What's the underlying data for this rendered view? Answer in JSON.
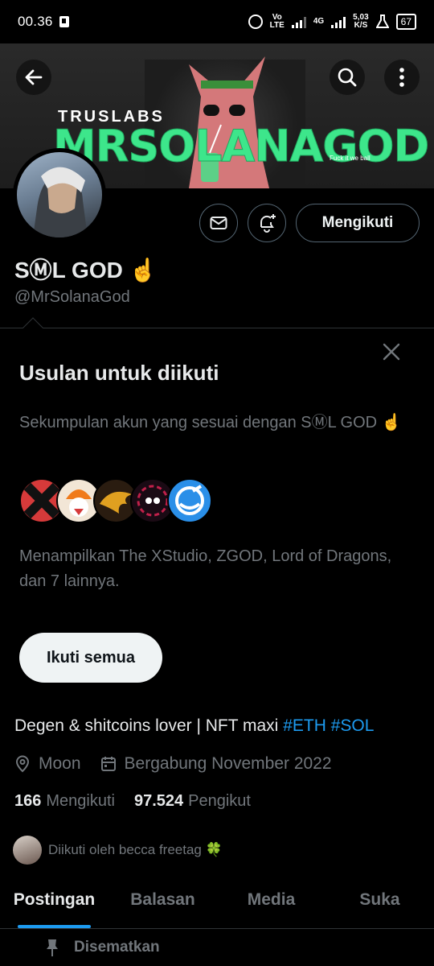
{
  "status_bar": {
    "time": "00.36",
    "volte": "Vo\nLTE",
    "network": "4G",
    "speed": "5,03\nK/S",
    "battery": "67"
  },
  "banner": {
    "brand": "TRUSLABS",
    "title": "MRSOLANAGOD",
    "tagline": "Fuck it we ball"
  },
  "profile": {
    "name": "SⓂ︎L GOD ☝️",
    "handle": "@MrSolanaGod",
    "following_button": "Mengikuti",
    "bio_text": "Degen & shitcoins lover | NFT maxi ",
    "bio_tag1": "#ETH",
    "bio_tag2": "#SOL",
    "location": "Moon",
    "joined": "Bergabung November 2022",
    "following_count": "166",
    "following_label": "Mengikuti",
    "followers_count": "97.524",
    "followers_label": "Pengikut",
    "followed_by": "Diikuti oleh becca freetag 🍀"
  },
  "suggestions": {
    "title": "Usulan untuk diikuti",
    "subtitle": "Sekumpulan akun yang sesuai dengan SⓂ︎L GOD ☝️",
    "description": "Menampilkan The XStudio, ZGOD, Lord of Dragons, dan 7 lainnya.",
    "follow_all": "Ikuti semua"
  },
  "tabs": [
    "Postingan",
    "Balasan",
    "Media",
    "Suka"
  ],
  "active_tab": "Postingan",
  "pinned_label": "Disematkan",
  "icons": [
    "back-arrow-icon",
    "search-icon",
    "more-vertical-icon",
    "mail-icon",
    "bell-plus-icon",
    "close-icon",
    "location-icon",
    "calendar-icon",
    "pin-icon"
  ],
  "colors": {
    "accent": "#1d9bf0",
    "banner_title": "#3de68b",
    "muted": "#71767b"
  }
}
